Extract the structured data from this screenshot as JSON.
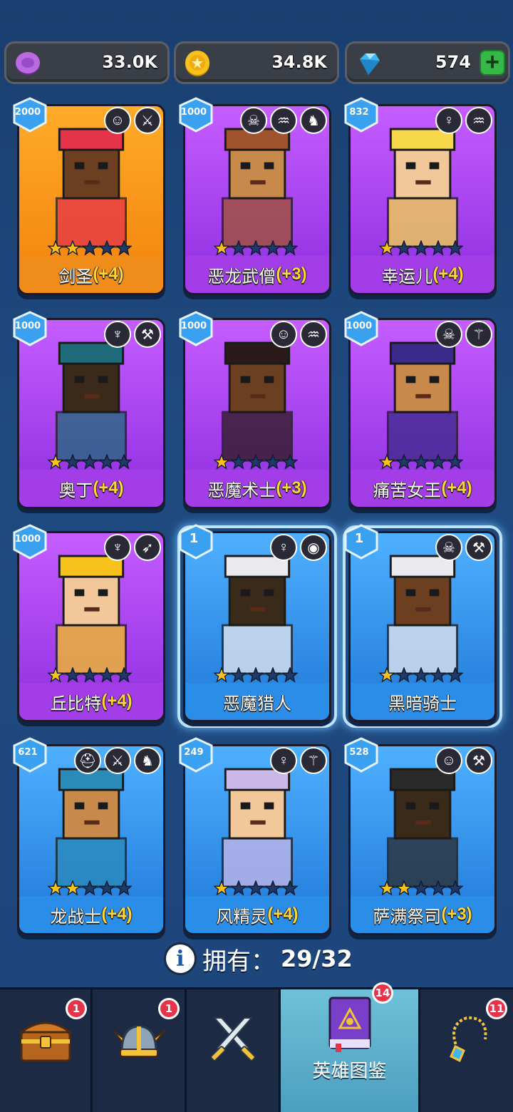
{
  "resources": [
    {
      "name": "purple-coin",
      "value": "33.0K",
      "color": "#b86ce0"
    },
    {
      "name": "gold-coin",
      "value": "34.8K",
      "color": "#f7c21c"
    },
    {
      "name": "gem",
      "value": "574",
      "color": "#3fb6f2"
    }
  ],
  "heroes": [
    {
      "name": "剑圣",
      "bonus": "(+4)",
      "level": "2000",
      "stars": 2,
      "rarity": "orange",
      "badges": [
        "orc-face-icon",
        "sword-icon"
      ]
    },
    {
      "name": "恶龙武僧",
      "bonus": "(+3)",
      "level": "1000",
      "stars": 1,
      "rarity": "purple",
      "badges": [
        "skull-icon",
        "dragon-icon",
        "dragon-head-icon"
      ]
    },
    {
      "name": "幸运儿",
      "bonus": "(+4)",
      "level": "832",
      "stars": 1,
      "rarity": "purple",
      "badges": [
        "elf-icon",
        "dragon-icon"
      ]
    },
    {
      "name": "奥丁",
      "bonus": "(+4)",
      "level": "1000",
      "stars": 1,
      "rarity": "purple",
      "badges": [
        "wings-icon",
        "hammer-icon"
      ]
    },
    {
      "name": "恶魔术士",
      "bonus": "(+3)",
      "level": "1000",
      "stars": 1,
      "rarity": "purple",
      "badges": [
        "orc-face-icon",
        "dragon-icon"
      ]
    },
    {
      "name": "痛苦女王",
      "bonus": "(+4)",
      "level": "1000",
      "stars": 1,
      "rarity": "purple",
      "badges": [
        "skull-icon",
        "staff-icon"
      ]
    },
    {
      "name": "丘比特",
      "bonus": "(+4)",
      "level": "1000",
      "stars": 1,
      "rarity": "purple",
      "badges": [
        "wings-icon",
        "bow-icon"
      ]
    },
    {
      "name": "恶魔猎人",
      "bonus": "",
      "level": "1",
      "stars": 1,
      "rarity": "blue",
      "selected": true,
      "badges": [
        "elf-icon",
        "eye-icon"
      ]
    },
    {
      "name": "黑暗骑士",
      "bonus": "",
      "level": "1",
      "stars": 1,
      "rarity": "blue",
      "selected": true,
      "badges": [
        "skull-icon",
        "hammer-icon"
      ]
    },
    {
      "name": "龙战士",
      "bonus": "(+4)",
      "level": "621",
      "stars": 2,
      "rarity": "blue",
      "badges": [
        "helmet-icon",
        "sword-icon",
        "dragon-head-icon"
      ]
    },
    {
      "name": "风精灵",
      "bonus": "(+4)",
      "level": "249",
      "stars": 1,
      "rarity": "blue",
      "badges": [
        "elf-icon",
        "staff-icon"
      ]
    },
    {
      "name": "萨满祭司",
      "bonus": "(+3)",
      "level": "528",
      "stars": 2,
      "rarity": "blue",
      "badges": [
        "orc-face-icon",
        "hammer-icon"
      ]
    }
  ],
  "owned": {
    "label": "拥有：",
    "count": "29/32"
  },
  "nav": [
    {
      "name": "chest",
      "notif": "1",
      "label": ""
    },
    {
      "name": "helmet",
      "notif": "1",
      "label": ""
    },
    {
      "name": "battle",
      "notif": "",
      "label": ""
    },
    {
      "name": "hero-book",
      "notif": "14",
      "label": "英雄图鉴",
      "active": true
    },
    {
      "name": "amulet",
      "notif": "11",
      "label": ""
    }
  ]
}
